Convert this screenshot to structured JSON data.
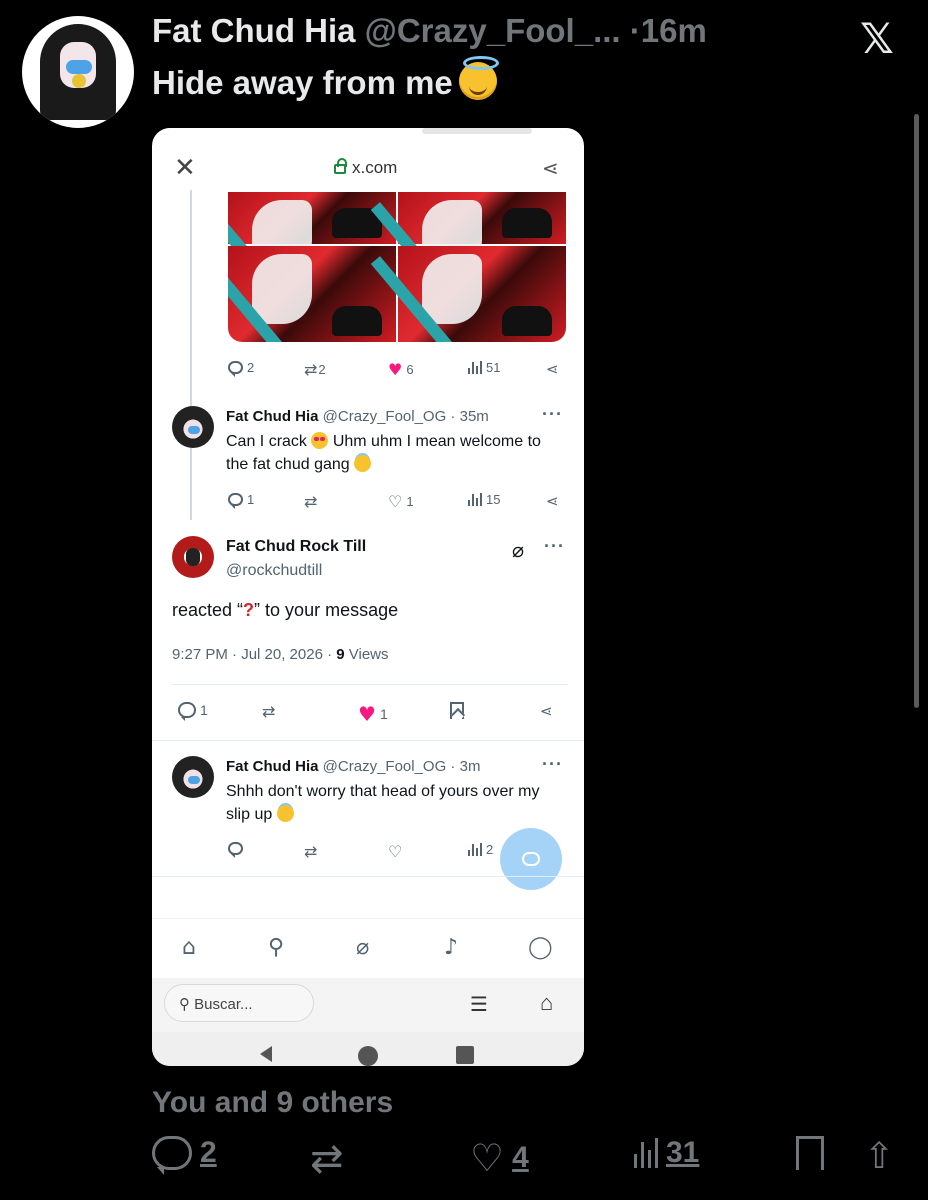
{
  "post": {
    "display_name": "Fat Chud Hia",
    "handle": "@Crazy_Fool_...",
    "separator": "·",
    "time": "16m",
    "text": "Hide away from me",
    "likes_line": "You and 9 others",
    "counts": {
      "replies": "2",
      "reposts": "",
      "likes": "4",
      "views": "31"
    }
  },
  "screenshot": {
    "url": "x.com",
    "tweet1_counts": {
      "replies": "2",
      "reposts": "2",
      "likes": "6",
      "views": "51"
    },
    "reply1": {
      "name": "Fat Chud Hia",
      "handle_time": "@Crazy_Fool_OG · 35m",
      "text_a": "Can I crack",
      "text_b": "Uhm uhm I mean welcome to the fat chud gang",
      "counts": {
        "replies": "1",
        "reposts": "",
        "likes": "1",
        "views": "15"
      }
    },
    "main": {
      "name": "Fat Chud Rock Till",
      "handle": "@rockchudtill",
      "text_a": "reacted “",
      "text_q": "?",
      "text_b": "” to your message",
      "time_date": "9:27 PM · Jul 20, 2026 · ",
      "views_num": "9",
      "views_label": " Views",
      "counts": {
        "replies": "1",
        "likes": "1"
      }
    },
    "reply2": {
      "name": "Fat Chud Hia",
      "handle_time": "@Crazy_Fool_OG · 3m",
      "text": "Shhh don't worry that head of yours over my slip up",
      "counts": {
        "views": "2"
      }
    },
    "search_placeholder": "Buscar..."
  },
  "icons": {
    "x_logo": "x-logo-icon",
    "close": "close-icon",
    "lock": "lock-icon",
    "share": "share-icon"
  },
  "colors": {
    "like": "#f91880",
    "background": "#000000",
    "muted": "#71767b"
  }
}
